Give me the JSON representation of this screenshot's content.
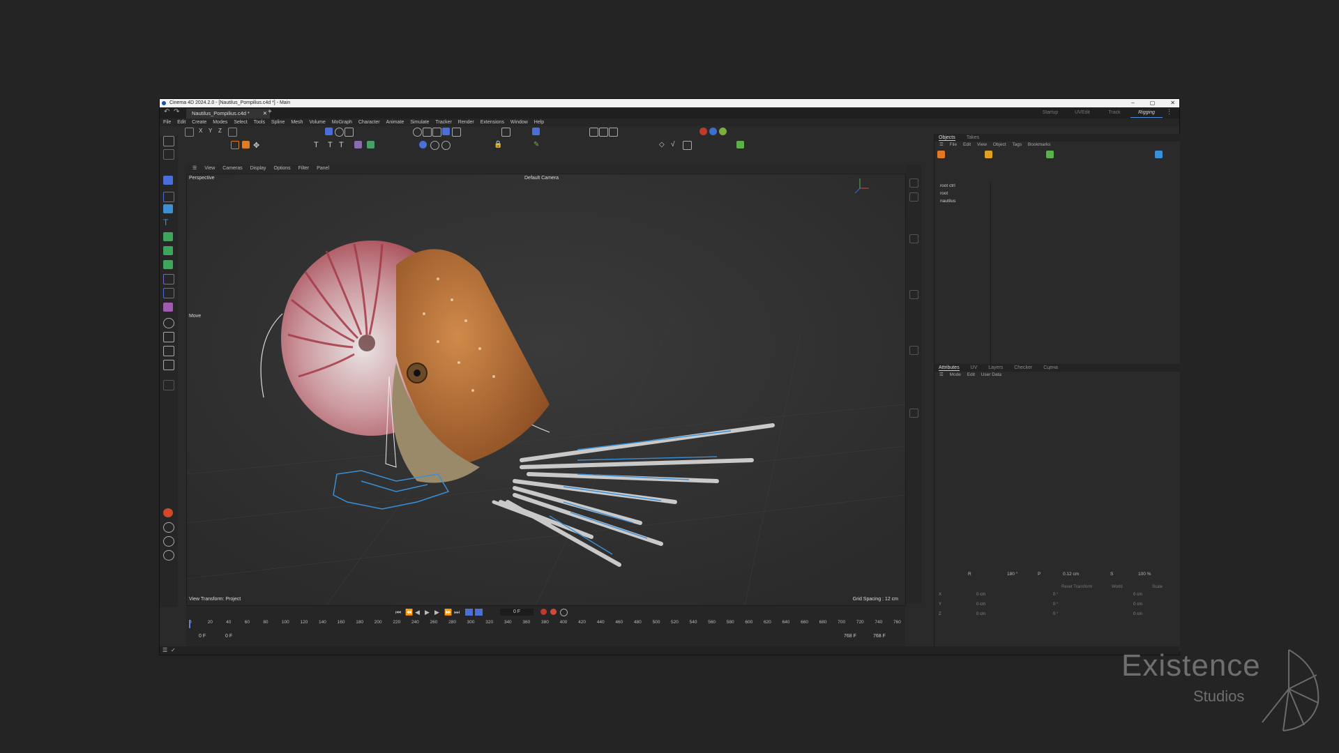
{
  "window": {
    "title": "Cinema 4D 2024.2.0 - [Nautilus_Pompilius.c4d *] - Main",
    "controls": [
      "–",
      "▢",
      "✕"
    ]
  },
  "doc_tab": {
    "label": "Nautilus_Pompilius.c4d *",
    "close": "✕",
    "add": "+"
  },
  "layouts": [
    "Startup",
    "UVEdit",
    "Track",
    "Rigging"
  ],
  "active_layout": "Rigging",
  "menu": [
    "File",
    "Edit",
    "Create",
    "Modes",
    "Select",
    "Tools",
    "Spline",
    "Mesh",
    "Volume",
    "MoGraph",
    "Character",
    "Animate",
    "Simulate",
    "Tracker",
    "Render",
    "Extensions",
    "Window",
    "Help"
  ],
  "viewport": {
    "menu": [
      "View",
      "Cameras",
      "Display",
      "Options",
      "Filter",
      "Panel"
    ],
    "projection": "Perspective",
    "camera": "Default Camera",
    "tool": "Move",
    "view_transform": "View Transform: Project",
    "grid_spacing": "Grid Spacing : 12 cm"
  },
  "objects_panel": {
    "tabs": [
      "Objects",
      "Takes"
    ],
    "menu": [
      "File",
      "Edit",
      "View",
      "Object",
      "Tags",
      "Bookmarks"
    ],
    "items": [
      "root ctrl",
      "root",
      "nautilus"
    ]
  },
  "attributes_panel": {
    "tabs": [
      "Attributes",
      "UV",
      "Layers",
      "Checker",
      "Сцена"
    ],
    "menu": [
      "Mode",
      "Edit",
      "User Data"
    ],
    "coord_labels": {
      "r": "R",
      "p": "P",
      "s": "S"
    },
    "coord_values": {
      "r": "180 °",
      "p": "0.12 cm",
      "s": "100 %"
    },
    "reset": "Reset Transform",
    "space": "World",
    "scale": "Scale",
    "axes": [
      "X",
      "Y",
      "Z"
    ],
    "rows": [
      {
        "pos": "0 cm",
        "rot": "0 °",
        "scl": "0 cm"
      },
      {
        "pos": "0 cm",
        "rot": "0 °",
        "scl": "0 cm"
      },
      {
        "pos": "0 cm",
        "rot": "0 °",
        "scl": "0 cm"
      }
    ]
  },
  "timeline": {
    "current_frame": "0 F",
    "ticks": [
      "0",
      "20",
      "40",
      "60",
      "80",
      "100",
      "120",
      "140",
      "160",
      "180",
      "200",
      "220",
      "240",
      "260",
      "280",
      "300",
      "320",
      "340",
      "360",
      "380",
      "400",
      "420",
      "440",
      "460",
      "480",
      "500",
      "520",
      "540",
      "560",
      "580",
      "600",
      "620",
      "640",
      "660",
      "680",
      "700",
      "720",
      "740",
      "760"
    ],
    "start": "0 F",
    "start2": "0 F",
    "end": "768 F",
    "end2": "768 F"
  },
  "watermark": {
    "line1": "Existence",
    "line2": "Studios"
  },
  "colors": {
    "accent": "#4a6fd9",
    "orange": "#e07a24",
    "shell": "#c0575d",
    "blue_rig": "#3a8fd6"
  }
}
